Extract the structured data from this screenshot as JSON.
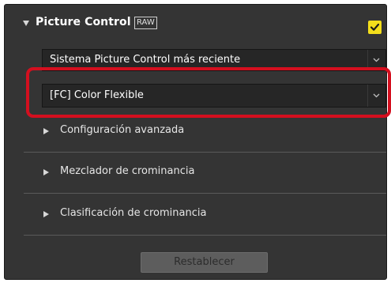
{
  "panel": {
    "title": "Picture Control",
    "raw_badge": "RAW",
    "enabled": true
  },
  "selects": {
    "version": {
      "value": "Sistema Picture Control más reciente"
    },
    "picture_control": {
      "value": "[FC] Color Flexible"
    }
  },
  "sections": [
    {
      "label": "Configuración avanzada"
    },
    {
      "label": "Mezclador de crominancia"
    },
    {
      "label": "Clasificación de crominancia"
    }
  ],
  "buttons": {
    "reset_label": "Restablecer"
  },
  "colors": {
    "panel_bg": "#343434",
    "checkbox_accent": "#f3de1b",
    "highlight": "#d40f1f"
  },
  "icons": {
    "collapse": "triangle-down-icon",
    "expand": "triangle-right-icon",
    "dropdown": "chevron-down-icon",
    "check": "checkmark-icon"
  }
}
